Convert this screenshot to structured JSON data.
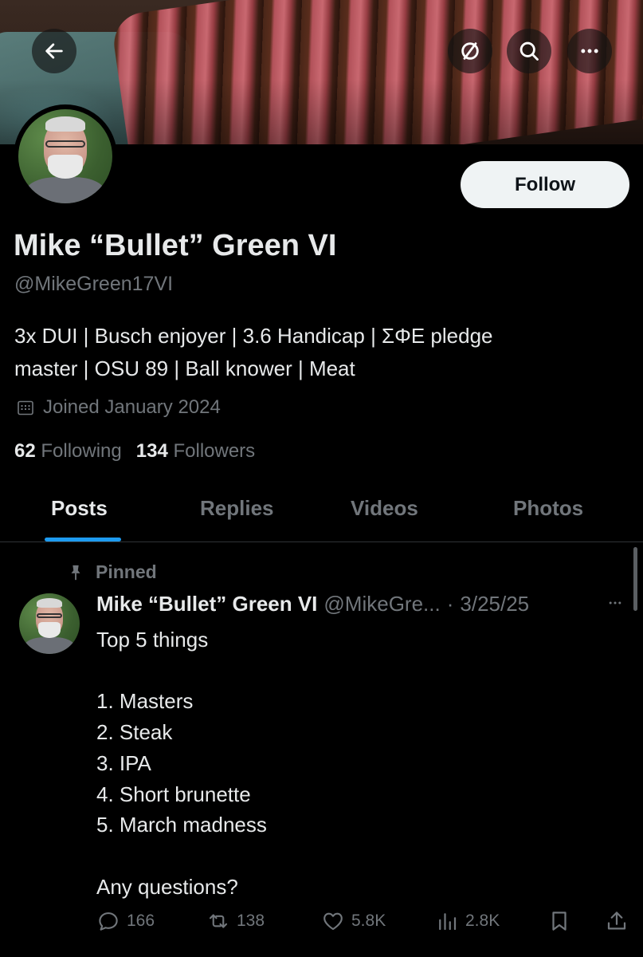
{
  "header": {
    "back_icon": "back-arrow-icon",
    "cancel_icon": "cancel-circle-icon",
    "search_icon": "search-icon",
    "more_icon": "more-horizontal-icon"
  },
  "profile": {
    "display_name": "Mike “Bullet” Green VI",
    "handle": "@MikeGreen17VI",
    "bio_lines": [
      "3x DUI | Busch enjoyer | 3.6 Handicap | ΣΦΕ pledge",
      "master | OSU 89 | Ball knower | Meat"
    ],
    "joined": "Joined January 2024",
    "following_count": "62",
    "following_label": "Following",
    "followers_count": "134",
    "followers_label": "Followers",
    "follow_label": "Follow"
  },
  "tabs": [
    {
      "label": "Posts",
      "active": true
    },
    {
      "label": "Replies",
      "active": false
    },
    {
      "label": "Videos",
      "active": false
    },
    {
      "label": "Photos",
      "active": false
    }
  ],
  "tweet": {
    "pinned_label": "Pinned",
    "author_name": "Mike “Bullet” Green VI",
    "author_handle": "@MikeGre...",
    "separator": "·",
    "date": "3/25/25",
    "lines": [
      "Top 5 things",
      "",
      "1. Masters",
      "2. Steak",
      "3. IPA",
      "4. Short brunette",
      "5. March madness",
      "",
      "Any questions?"
    ],
    "replies": "166",
    "reposts": "138",
    "likes": "5.8K",
    "views": "2.8K"
  },
  "colors": {
    "background": "#000000",
    "text_primary": "#e7e9ea",
    "text_secondary": "#71767b",
    "accent": "#1d9bf0",
    "follow_button_bg": "#eff3f4"
  }
}
